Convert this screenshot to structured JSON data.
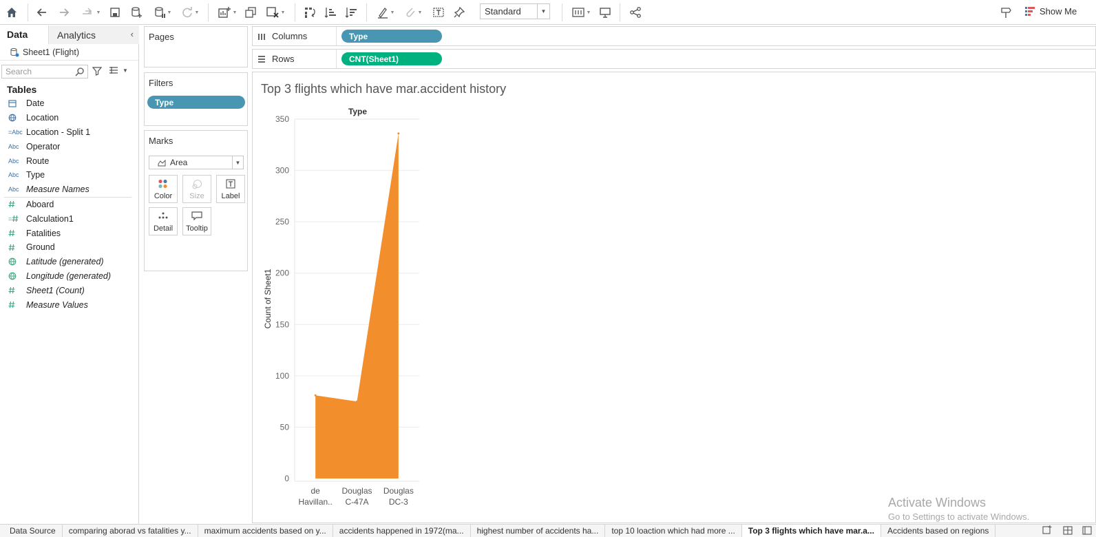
{
  "toolbar": {
    "mark_type_select": "Standard",
    "show_me": "Show Me"
  },
  "data_pane": {
    "tabs": [
      "Data",
      "Analytics"
    ],
    "datasource": "Sheet1 (Flight)",
    "search_placeholder": "Search",
    "tables_header": "Tables",
    "dimensions": [
      {
        "name": "Date",
        "icon": "calendar-icon"
      },
      {
        "name": "Location",
        "icon": "globe-icon"
      },
      {
        "name": "Location - Split 1",
        "icon": "calc-abc-icon"
      },
      {
        "name": "Operator",
        "icon": "abc-icon"
      },
      {
        "name": "Route",
        "icon": "abc-icon"
      },
      {
        "name": "Type",
        "icon": "abc-icon"
      },
      {
        "name": "Measure Names",
        "icon": "abc-icon"
      }
    ],
    "measures": [
      {
        "name": "Aboard",
        "icon": "number-icon"
      },
      {
        "name": "Calculation1",
        "icon": "calc-number-icon"
      },
      {
        "name": "Fatalities",
        "icon": "number-icon"
      },
      {
        "name": "Ground",
        "icon": "number-icon"
      },
      {
        "name": "Latitude (generated)",
        "icon": "globe-icon"
      },
      {
        "name": "Longitude (generated)",
        "icon": "globe-icon"
      },
      {
        "name": "Sheet1 (Count)",
        "icon": "number-icon"
      },
      {
        "name": "Measure Values",
        "icon": "number-icon"
      }
    ]
  },
  "cards": {
    "pages_title": "Pages",
    "filters_title": "Filters",
    "filter_pill": "Type",
    "marks_title": "Marks",
    "mark_type": "Area",
    "mark_buttons": {
      "color": "Color",
      "size": "Size",
      "label": "Label",
      "detail": "Detail",
      "tooltip": "Tooltip"
    }
  },
  "shelves": {
    "columns_label": "Columns",
    "columns_pill": "Type",
    "rows_label": "Rows",
    "rows_pill": "CNT(Sheet1)"
  },
  "viz": {
    "title": "Top 3 flights which have mar.accident history"
  },
  "chart_data": {
    "type": "area",
    "header": "Type",
    "categories": [
      "de Havillan..",
      "Douglas C-47A",
      "Douglas DC-3"
    ],
    "category_lines": [
      [
        "de",
        "Havillan.."
      ],
      [
        "Douglas",
        "C-47A"
      ],
      [
        "Douglas",
        "DC-3"
      ]
    ],
    "values": [
      81,
      75,
      336
    ],
    "ylabel": "Count of Sheet1",
    "yticks": [
      0,
      50,
      100,
      150,
      200,
      250,
      300,
      350
    ],
    "ylim": [
      0,
      350
    ],
    "color": "#f28e2b",
    "grid": true
  },
  "watermark": {
    "line1": "Activate Windows",
    "line2": "Go to Settings to activate Windows."
  },
  "sheet_tabs": [
    {
      "label": "Data Source",
      "active": false
    },
    {
      "label": "comparing aborad vs fatalities y...",
      "active": false
    },
    {
      "label": "maximum accidents based on y...",
      "active": false
    },
    {
      "label": "accidents happened in 1972(ma...",
      "active": false
    },
    {
      "label": "highest number of accidents ha...",
      "active": false
    },
    {
      "label": "top 10 loaction which had more ...",
      "active": false
    },
    {
      "label": "Top 3 flights which have mar.a...",
      "active": true
    },
    {
      "label": "Accidents based on regions",
      "active": false
    }
  ]
}
